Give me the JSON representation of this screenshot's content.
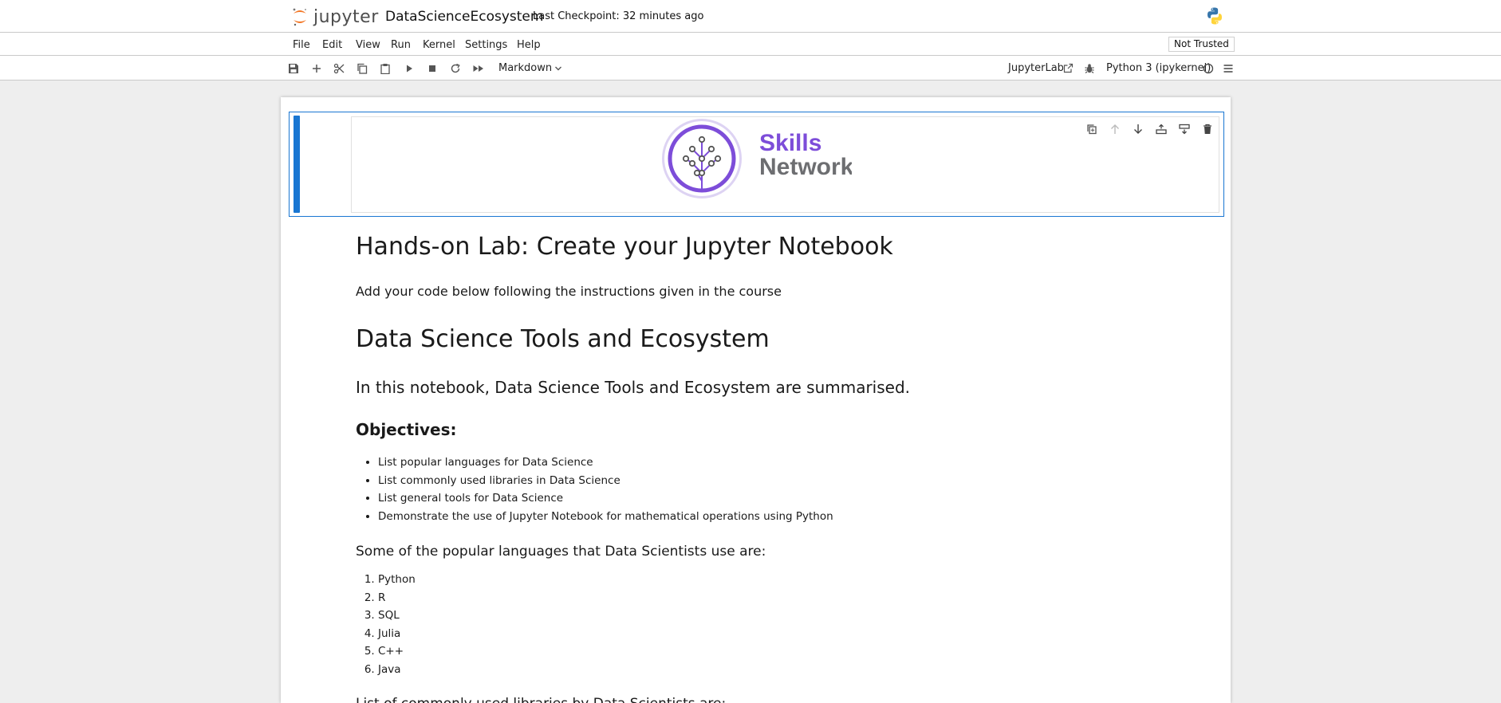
{
  "header": {
    "logo_text": "jupyter",
    "notebook_title": "DataScienceEcosystem",
    "checkpoint": "Last Checkpoint: 32 minutes ago"
  },
  "menu": {
    "items": [
      "File",
      "Edit",
      "View",
      "Run",
      "Kernel",
      "Settings",
      "Help"
    ],
    "trust_label": "Not Trusted"
  },
  "toolbar": {
    "cell_type": "Markdown",
    "jupyterlab_label": "JupyterLab",
    "kernel_label": "Python 3 (ipykernel)"
  },
  "logo_cell": {
    "brand_line1": "Skills",
    "brand_line2": "Network"
  },
  "notebook": {
    "title": "Hands-on Lab: Create your Jupyter Notebook",
    "intro": "Add your code below following the instructions given in the course",
    "section_title": "Data Science Tools and Ecosystem",
    "summary": "In this notebook, Data Science Tools and Ecosystem are summarised.",
    "objectives_heading": "Objectives:",
    "objectives": [
      "List popular languages for Data Science",
      "List commonly used libraries in Data Science",
      "List general tools for Data Science",
      "Demonstrate the use of Jupyter Notebook for mathematical operations using Python"
    ],
    "languages_heading": "Some of the popular languages that Data Scientists use are:",
    "languages": [
      "Python",
      "R",
      "SQL",
      "Julia",
      "C++",
      "Java"
    ],
    "libraries_heading": "List of commonly used libraries by Data Scientists are:"
  },
  "colors": {
    "accent": "#1976d2",
    "brand_purple": "#7d4dd9",
    "brand_gray": "#6d6e71"
  }
}
